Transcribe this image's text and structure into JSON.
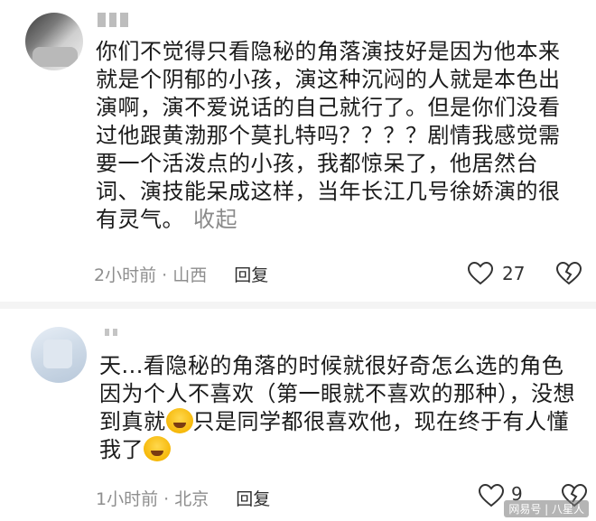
{
  "comments": [
    {
      "text": "你们不觉得只看隐秘的角落演技好是因为他本来就是个阴郁的小孩，演这种沉闷的人就是本色出演啊，演不爱说话的自己就行了。但是你们没看过他跟黄渤那个莫扎特吗？？？？剧情我感觉需要一个活泼点的小孩，我都惊呆了，他居然台词、演技能呆成这样，当年长江几号徐娇演的很有灵气。",
      "collapse_label": "收起",
      "time_location": "2小时前 · 山西",
      "reply_label": "回复",
      "likes": "27"
    },
    {
      "text_part1": "天...看隐秘的角落的时候就很好奇怎么选的角色因为个人不喜欢（第一眼就不喜欢的那种），没想到真就",
      "text_part2": "只是同学都很喜欢他，现在终于有人懂我了",
      "time_location": "1小时前 · 北京",
      "reply_label": "回复",
      "likes": "9"
    }
  ],
  "icons": {
    "like": "heart-outline-icon",
    "dislike": "broken-heart-icon",
    "emoji_laugh": "rolling-laughing-emoji",
    "emoji_cry": "crying-emoji"
  },
  "watermark": "网易号 | 八星人",
  "colors": {
    "text": "#1b1b1b",
    "meta": "#8e8e8e",
    "divider": "#f4f4f4"
  }
}
